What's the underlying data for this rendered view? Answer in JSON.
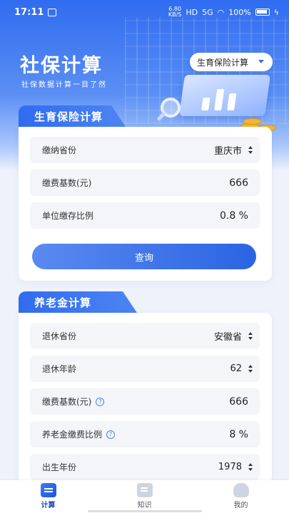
{
  "status_bar": {
    "time": "17:11",
    "speed": "6.80",
    "speed_unit": "KB/S",
    "hd": "HD",
    "net": "5G",
    "battery": "100%"
  },
  "header": {
    "title": "社保计算",
    "subtitle": "社保数据计算一目了然",
    "type_select": "生育保险计算"
  },
  "maternity": {
    "heading": "生育保险计算",
    "rows": [
      {
        "label": "缴纳省份",
        "value": "重庆市"
      },
      {
        "label": "缴费基数(元)",
        "value": "666"
      },
      {
        "label": "单位缴存比例",
        "value": "0.8 %"
      }
    ],
    "query_label": "查询"
  },
  "pension": {
    "heading": "养老金计算",
    "rows": [
      {
        "label": "退休省份",
        "value": "安徽省"
      },
      {
        "label": "退休年龄",
        "value": "62"
      },
      {
        "label": "缴费基数(元)",
        "value": "666"
      },
      {
        "label": "养老金缴费比例",
        "value": "8 %"
      },
      {
        "label": "出生年份",
        "value": "1978"
      }
    ]
  },
  "bottom_nav": [
    {
      "label": "计算",
      "icon": "calculator-icon"
    },
    {
      "label": "知识",
      "icon": "document-icon"
    },
    {
      "label": "我的",
      "icon": "profile-icon"
    }
  ],
  "colors": {
    "accent": "#2f6cf0",
    "background": "#eef2fb"
  }
}
